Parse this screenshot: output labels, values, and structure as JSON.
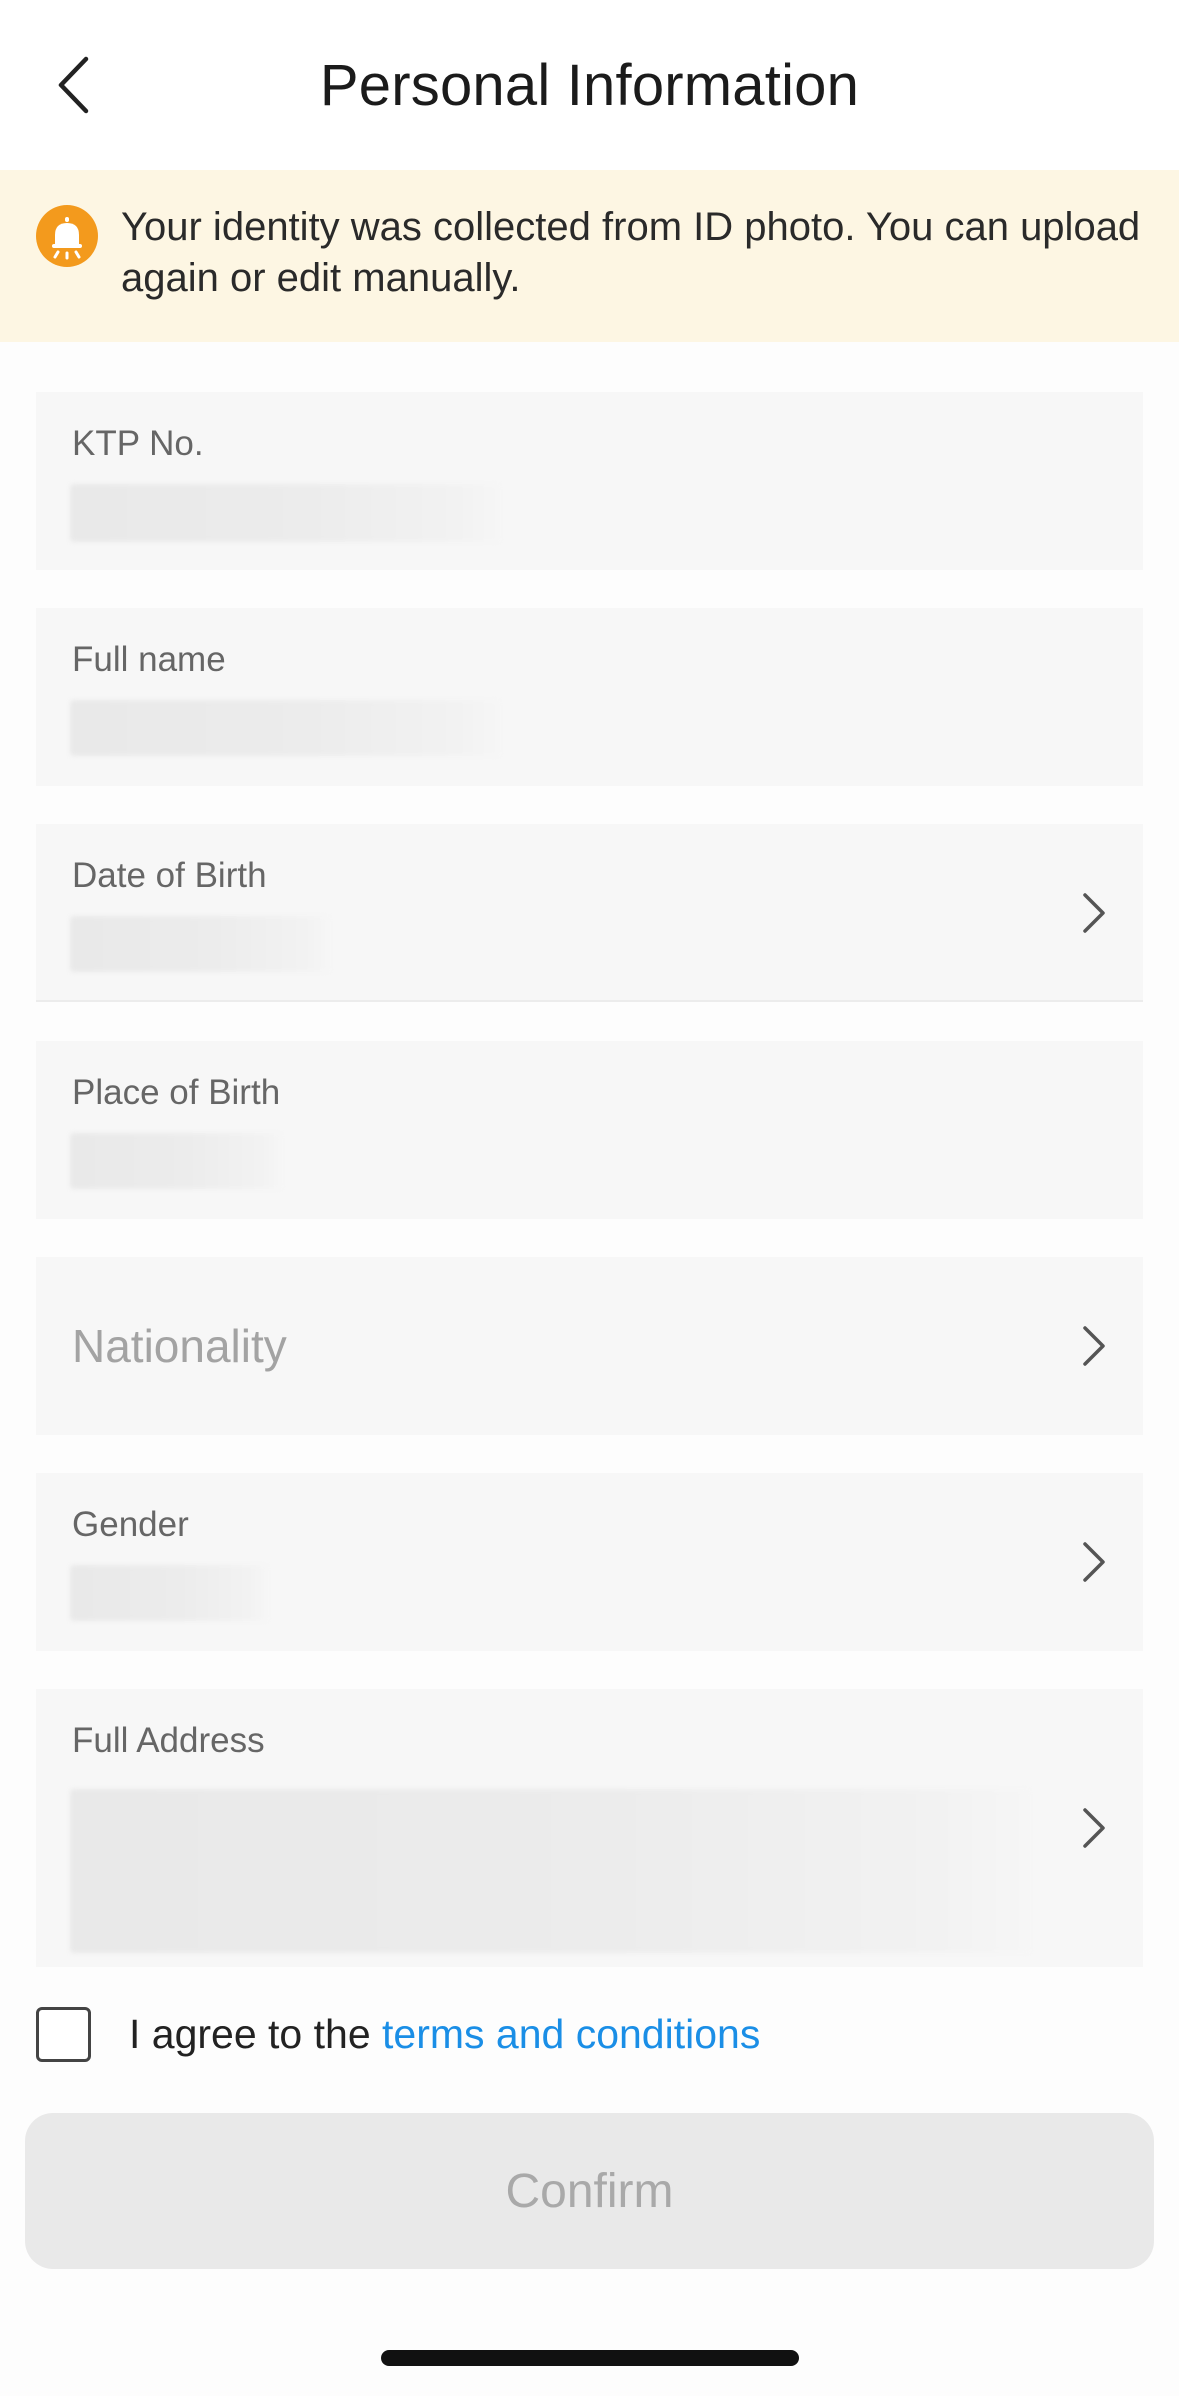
{
  "header": {
    "title": "Personal Information",
    "back_icon": "chevron-left-icon"
  },
  "banner": {
    "icon": "bell-icon",
    "icon_color": "#f39a1d",
    "text": "Your identity was collected from ID photo. You can upload again or edit manually."
  },
  "fields": [
    {
      "label": "KTP No.",
      "has_chevron": false
    },
    {
      "label": "Full name",
      "has_chevron": false
    },
    {
      "label": "Date of Birth",
      "has_chevron": true
    },
    {
      "label": "Place of Birth",
      "has_chevron": false
    },
    {
      "placeholder": "Nationality",
      "has_chevron": true
    },
    {
      "label": "Gender",
      "has_chevron": true
    },
    {
      "label": "Full Address",
      "has_chevron": true
    }
  ],
  "agreement": {
    "prefix": "I agree to the ",
    "link": "terms and conditions",
    "link_color": "#1a8ee6",
    "checked": false
  },
  "confirm_button": {
    "label": "Confirm",
    "enabled": false
  }
}
